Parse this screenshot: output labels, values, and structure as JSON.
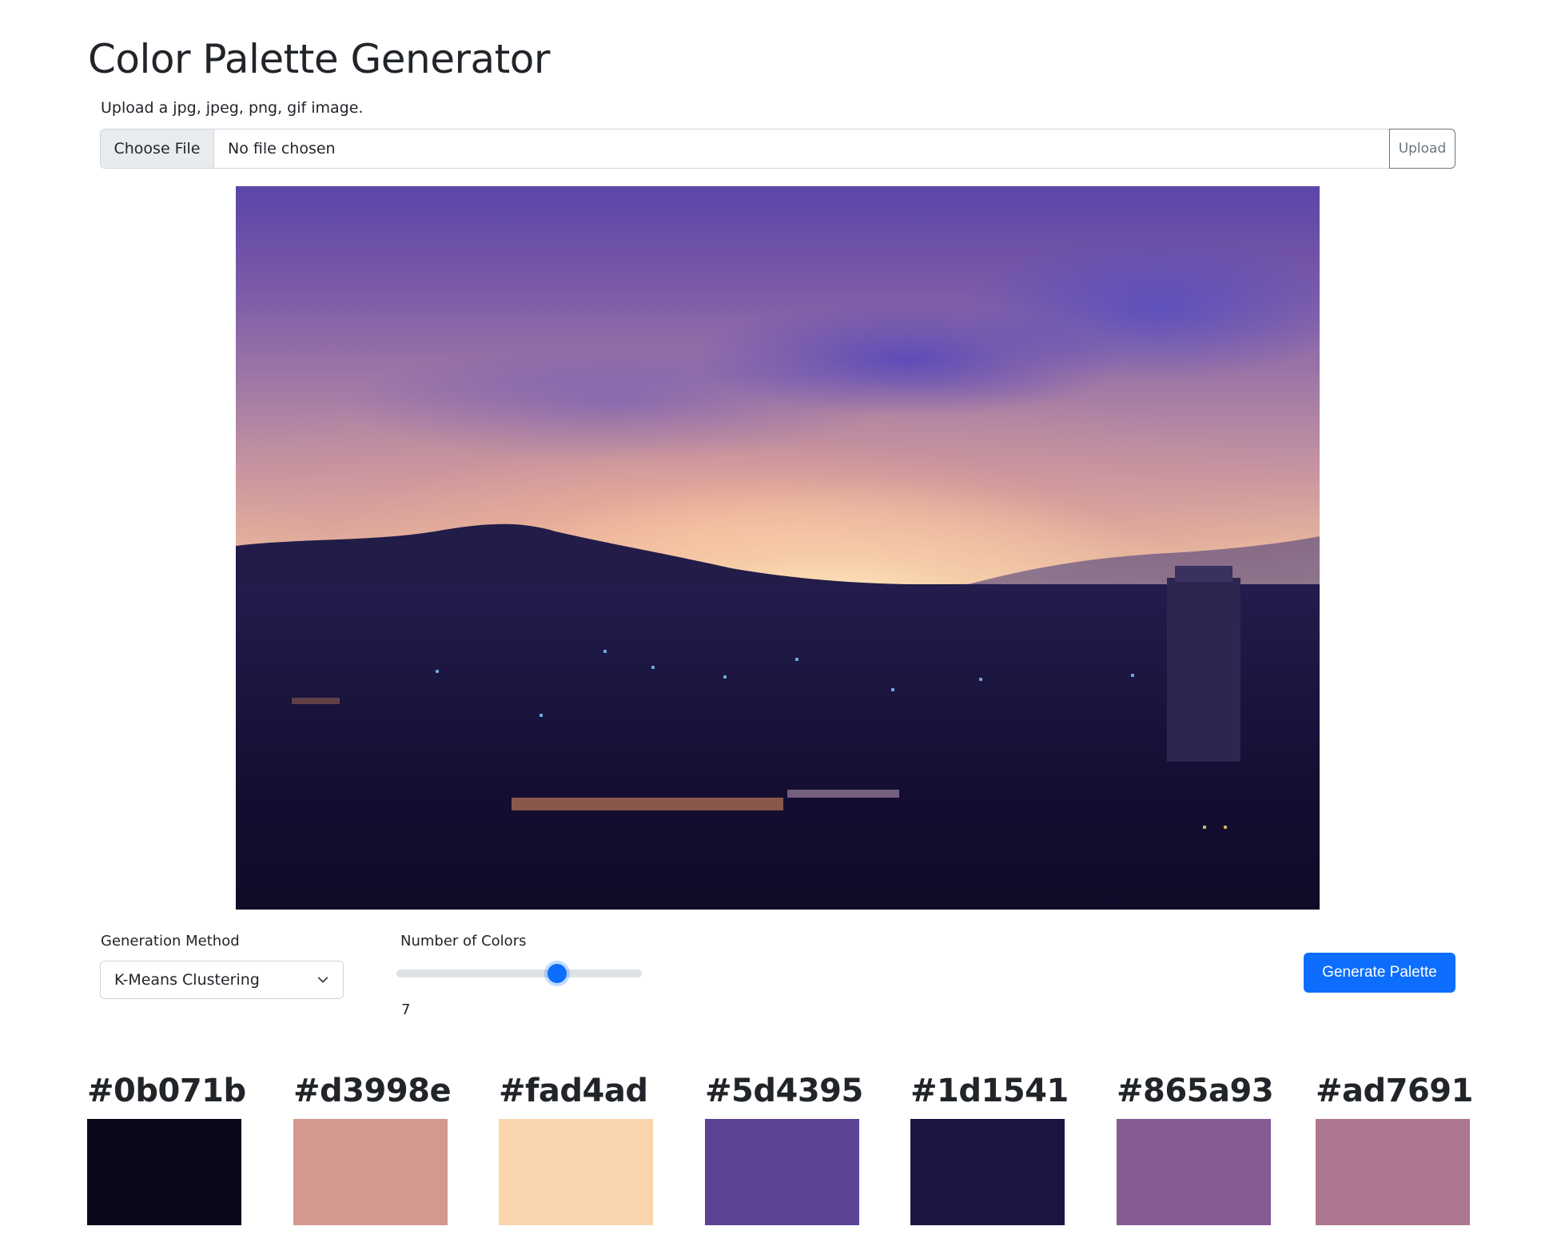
{
  "header": {
    "title": "Color Palette Generator",
    "upload_hint": "Upload a jpg, jpeg, png, gif image."
  },
  "file_upload": {
    "choose_label": "Choose File",
    "file_name": "No file chosen",
    "upload_label": "Upload"
  },
  "preview": {
    "description": "Sunset over a city skyline with purple and orange clouds"
  },
  "controls": {
    "method_label": "Generation Method",
    "method_value": "K-Means Clustering",
    "count_label": "Number of Colors",
    "count_value": "7",
    "count_min": 1,
    "count_max": 10,
    "count_fraction": 0.667,
    "generate_label": "Generate Palette"
  },
  "colors": {
    "primary": "#0d6efd",
    "text": "#212529",
    "border": "#ced4da",
    "secondary": "#6c757d"
  },
  "palette": [
    {
      "hex": "#0b071b"
    },
    {
      "hex": "#d3998e"
    },
    {
      "hex": "#fad4ad"
    },
    {
      "hex": "#5d4395"
    },
    {
      "hex": "#1d1541"
    },
    {
      "hex": "#865a93"
    },
    {
      "hex": "#ad7691"
    }
  ]
}
